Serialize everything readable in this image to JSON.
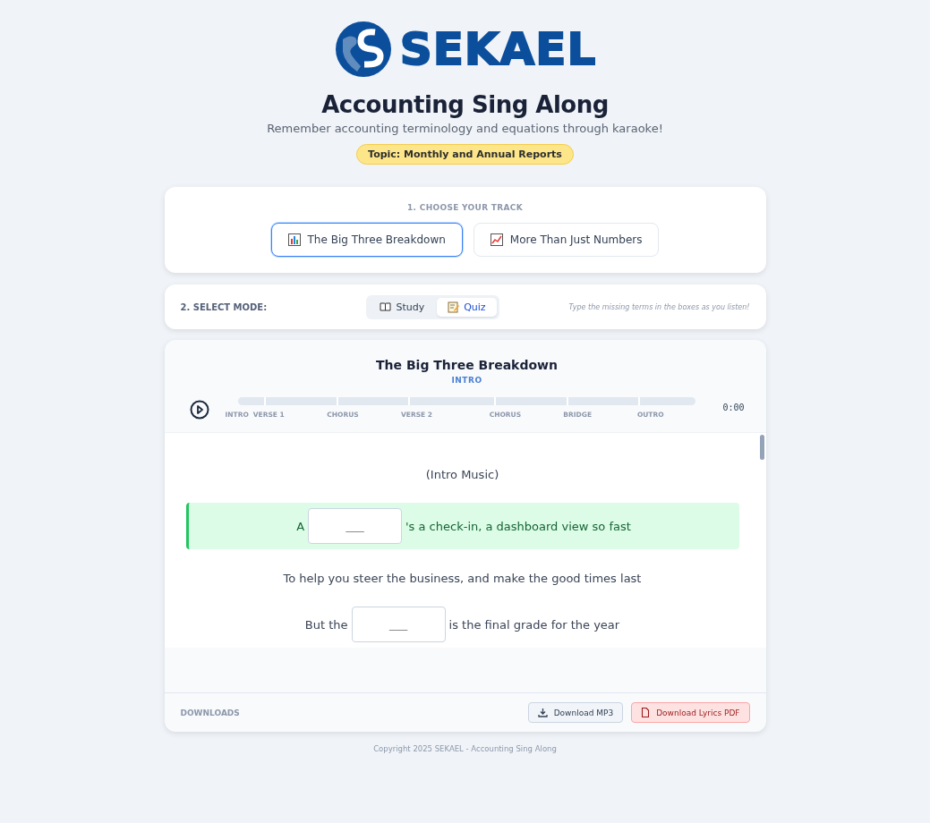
{
  "logo": {
    "text": "SEKAEL"
  },
  "title": "Accounting Sing Along",
  "subtitle": "Remember accounting terminology and equations through karaoke!",
  "topic_badge": "Topic: Monthly and Annual Reports",
  "track_section": {
    "heading": "1. CHOOSE YOUR TRACK",
    "tracks": [
      {
        "label": "The Big Three Breakdown",
        "kind": "bar-chart",
        "selected": true
      },
      {
        "label": "More Than Just Numbers",
        "kind": "line-chart",
        "selected": false
      }
    ]
  },
  "mode_section": {
    "heading": "2. SELECT MODE:",
    "modes": [
      {
        "label": "Study",
        "kind": "book",
        "selected": false
      },
      {
        "label": "Quiz",
        "kind": "memo",
        "selected": true
      }
    ],
    "hint": "Type the missing terms in the boxes as you listen!"
  },
  "player": {
    "title": "The Big Three Breakdown",
    "current_section": "INTRO",
    "time": "0:00",
    "sections": [
      {
        "label": "INTRO"
      },
      {
        "label": "VERSE 1"
      },
      {
        "label": "CHORUS"
      },
      {
        "label": "VERSE 2"
      },
      {
        "label": "CHORUS"
      },
      {
        "label": "BRIDGE"
      },
      {
        "label": "OUTRO"
      }
    ]
  },
  "lyrics": [
    {
      "active": false,
      "segments": [
        {
          "kind": "text",
          "text": "(Intro Music)"
        }
      ]
    },
    {
      "active": true,
      "segments": [
        {
          "kind": "text",
          "text": "A"
        },
        {
          "kind": "blank",
          "placeholder": "___"
        },
        {
          "kind": "text",
          "text": "'s a check-in, a dashboard view so fast"
        }
      ]
    },
    {
      "active": false,
      "segments": [
        {
          "kind": "text",
          "text": "To help you steer the business, and make the good times last"
        }
      ]
    },
    {
      "active": false,
      "segments": [
        {
          "kind": "text",
          "text": "But the"
        },
        {
          "kind": "blank",
          "placeholder": "___"
        },
        {
          "kind": "text",
          "text": "is the final grade for the year"
        }
      ]
    }
  ],
  "downloads": {
    "heading": "DOWNLOADS",
    "buttons": [
      {
        "label": "Download MP3",
        "kind": "mp3"
      },
      {
        "label": "Download Lyrics PDF",
        "kind": "pdf"
      }
    ]
  },
  "footer": "Copyright 2025 SEKAEL - Accounting Sing Along"
}
